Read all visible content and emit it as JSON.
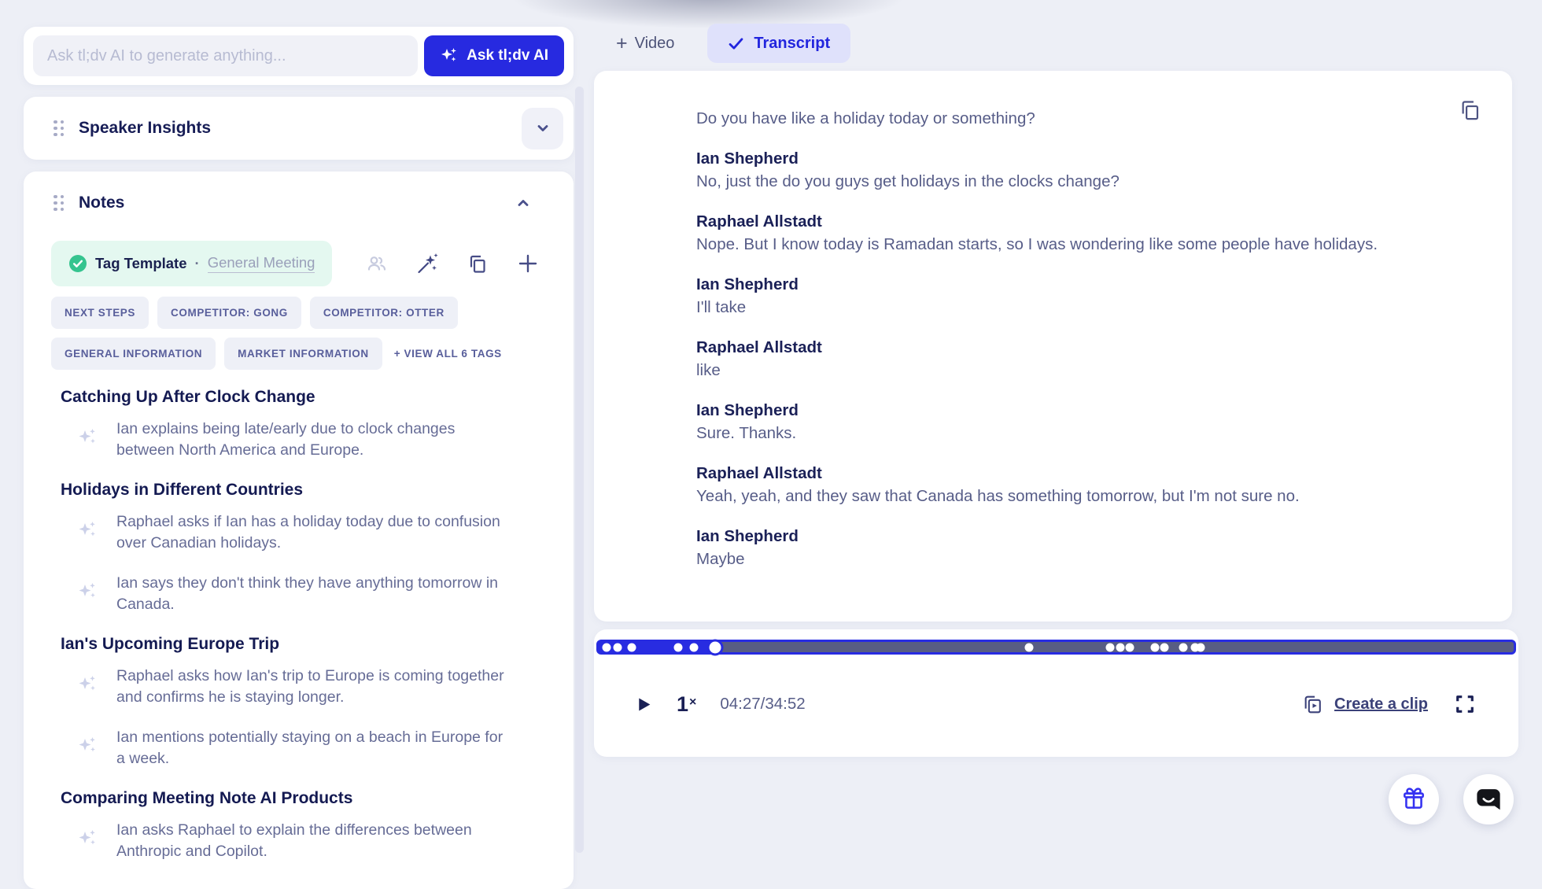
{
  "colors": {
    "accent_blue": "#272ae0",
    "transcript_pill_bg": "#dfe1fb",
    "mint_bg": "#e4f8f0",
    "check_green": "#35c48f",
    "progress_track": "#585d83",
    "navy_text": "#171d56",
    "body_text": "#575d88",
    "page_bg": "#edeff6"
  },
  "ai_bar": {
    "placeholder": "Ask tl;dv AI to generate anything...",
    "button": "Ask tl;dv AI"
  },
  "speaker_insights": {
    "title": "Speaker Insights"
  },
  "notes": {
    "title": "Notes",
    "template_label": "Tag Template",
    "template_sep": "·",
    "template_name": "General Meeting",
    "tags": [
      "NEXT STEPS",
      "COMPETITOR: GONG",
      "COMPETITOR: OTTER",
      "GENERAL INFORMATION",
      "MARKET INFORMATION"
    ],
    "view_all": "+ VIEW ALL 6 TAGS",
    "groups": [
      {
        "heading": "Catching Up After Clock Change",
        "bullets": [
          "Ian explains being late/early due to clock changes between North America and Europe."
        ]
      },
      {
        "heading": "Holidays in Different Countries",
        "bullets": [
          "Raphael asks if Ian has a holiday today due to confusion over Canadian holidays.",
          "Ian says they don't think they have anything tomorrow in Canada."
        ]
      },
      {
        "heading": "Ian's Upcoming Europe Trip",
        "bullets": [
          "Raphael asks how Ian's trip to Europe is coming together and confirms he is staying longer.",
          "Ian mentions potentially staying on a beach in Europe for a week."
        ]
      },
      {
        "heading": "Comparing Meeting Note AI Products",
        "bullets": [
          "Ian asks Raphael to explain the differences between Anthropic and Copilot."
        ]
      }
    ]
  },
  "tabs": {
    "video": "Video",
    "transcript": "Transcript"
  },
  "transcript": {
    "lead": "Do you have like a holiday today or something?",
    "entries": [
      {
        "speaker": "Ian Shepherd",
        "text": "No, just the do you guys get holidays in the clocks change?"
      },
      {
        "speaker": "Raphael Allstadt",
        "text": "Nope. But I know today is Ramadan starts, so I was wondering like some people have holidays."
      },
      {
        "speaker": "Ian Shepherd",
        "text": "I'll take"
      },
      {
        "speaker": "Raphael Allstadt",
        "text": "like"
      },
      {
        "speaker": "Ian Shepherd",
        "text": "Sure. Thanks."
      },
      {
        "speaker": "Raphael Allstadt",
        "text": "Yeah, yeah, and they saw that Canada has something tomorrow, but I'm not sure no."
      },
      {
        "speaker": "Ian Shepherd",
        "text": "Maybe"
      }
    ]
  },
  "player": {
    "speed_value": "1",
    "speed_mult": "×",
    "time": "04:27/34:52",
    "create_clip": "Create a clip",
    "progress_percent": 12.75,
    "markers": [
      0.9,
      2.1,
      3.6,
      8.7,
      10.4,
      47.0,
      55.9,
      57.0,
      58.0,
      60.8,
      61.8,
      63.9,
      65.2,
      65.8
    ]
  },
  "icons": {
    "ask_button": "sparkles-icon",
    "section_handle": "drag-handle-icon",
    "speaker_insights_toggle": "chevron-down-icon",
    "notes_toggle": "chevron-up-icon",
    "tag_template_status": "check-circle-icon",
    "note_tools": [
      "people-icon",
      "magic-wand-icon",
      "copy-icon",
      "plus-icon"
    ],
    "video_tab": "plus-icon",
    "transcript_tab": "check-icon",
    "transcript_action": "copy-icon",
    "player": [
      "play-icon",
      "clip-icon",
      "fullscreen-icon"
    ],
    "floating": [
      "gift-icon",
      "chat-icon"
    ]
  }
}
